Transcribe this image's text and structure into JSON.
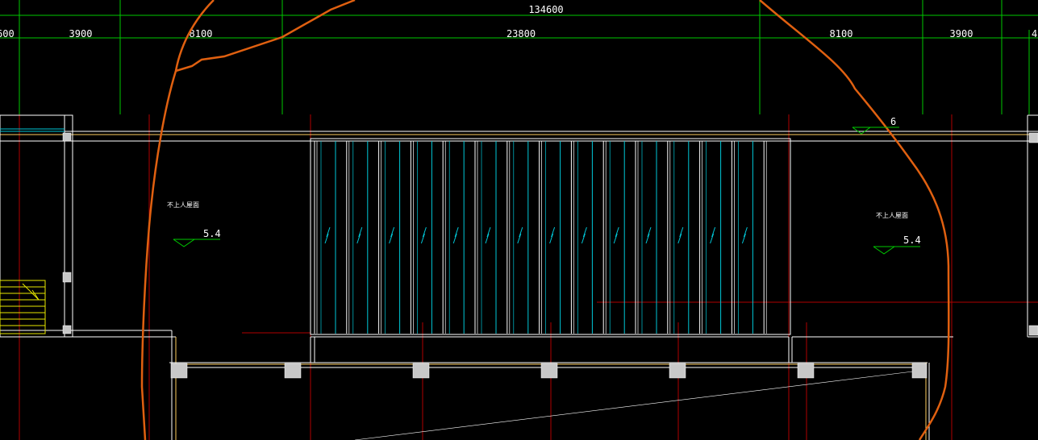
{
  "dimensions": {
    "overall": "134600",
    "segments": [
      "600",
      "3900",
      "8100",
      "23800",
      "8100",
      "3900",
      "4"
    ]
  },
  "annotations": {
    "roof_note_left": "不上人屋面",
    "roof_note_right": "不上人屋面",
    "level_left": "5.4",
    "level_right": "5.4",
    "level_top_right": "6"
  },
  "colors": {
    "background": "#000000",
    "grid": "#00c800",
    "outline": "#ffffff",
    "axis": "#c80000",
    "glass": "#00c8d8",
    "stair": "#e8e800",
    "boundary": "#e06010",
    "column": "#c8c8c8"
  }
}
